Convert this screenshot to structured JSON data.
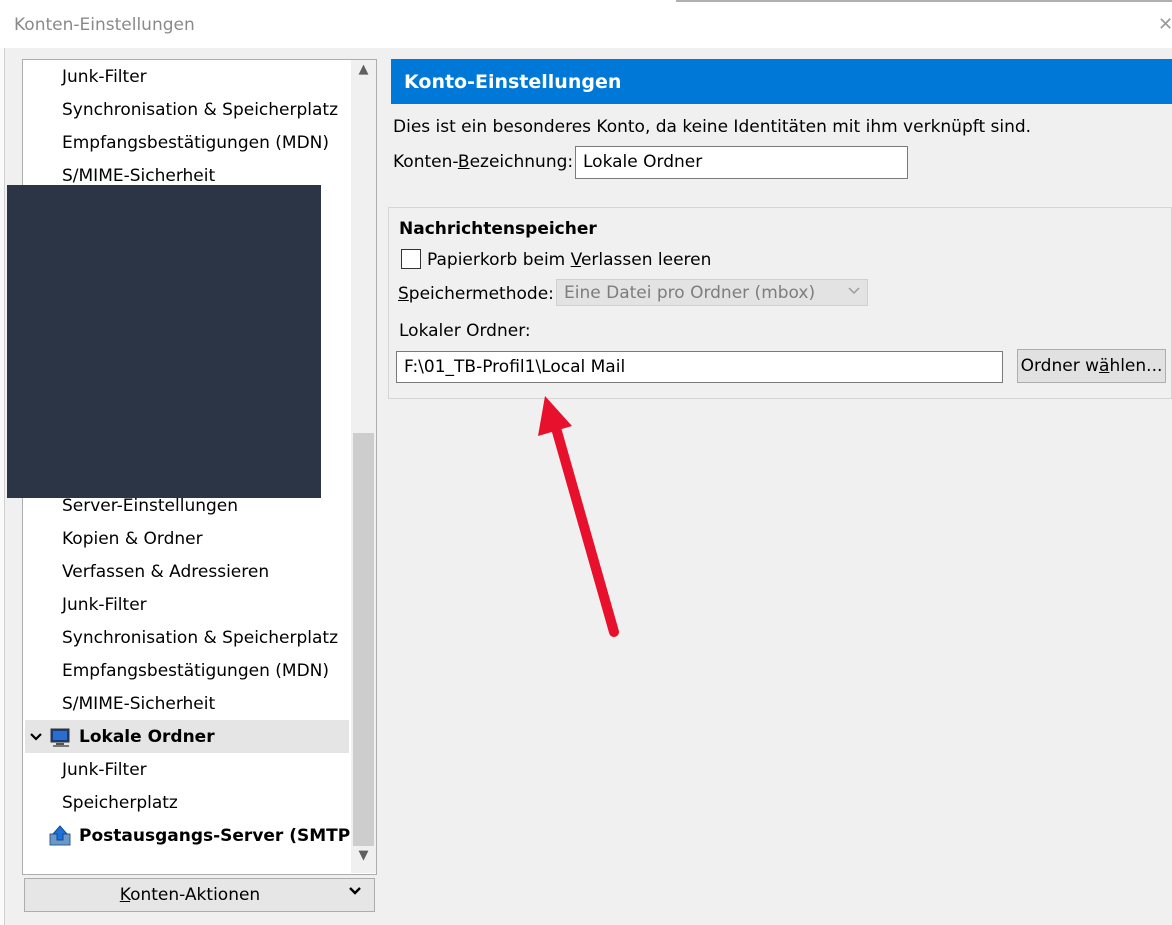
{
  "window": {
    "title": "Konten-Einstellungen",
    "close_glyph": "✕"
  },
  "tree": {
    "items": [
      {
        "label": "Junk-Filter"
      },
      {
        "label": "Synchronisation & Speicherplatz"
      },
      {
        "label": "Empfangsbestätigungen (MDN)"
      },
      {
        "label": "S/MIME-Sicherheit"
      },
      {
        "label": "Server-Einstellungen"
      },
      {
        "label": "Kopien & Ordner"
      },
      {
        "label": "Verfassen & Adressieren"
      },
      {
        "label": "Junk-Filter"
      },
      {
        "label": "Synchronisation & Speicherplatz"
      },
      {
        "label": "Empfangsbestätigungen (MDN)"
      },
      {
        "label": "S/MIME-Sicherheit"
      },
      {
        "label": "Lokale Ordner",
        "bold": true,
        "expanded": true,
        "icon": "computer-icon",
        "selected": true
      },
      {
        "label": "Junk-Filter"
      },
      {
        "label": "Speicherplatz"
      },
      {
        "label": "Postausgangs-Server (SMTP)",
        "bold": true,
        "icon": "upload-icon"
      }
    ]
  },
  "actions": {
    "label_prefix": "",
    "label_underlined": "K",
    "label_rest": "onten-Aktionen"
  },
  "panel": {
    "header": "Konto-Einstellungen",
    "notice": "Dies ist ein besonderes Konto, da keine Identitäten mit ihm verknüpft sind.",
    "name_label_pre": "Konten-",
    "name_label_ul": "B",
    "name_label_post": "ezeichnung:",
    "name_value": "Lokale Ordner",
    "group_title": "Nachrichtenspeicher",
    "checkbox_pre": "Papierkorb beim ",
    "checkbox_ul": "V",
    "checkbox_post": "erlassen leeren",
    "checkbox_checked": false,
    "method_ul": "S",
    "method_post": "peichermethode:",
    "method_value": "Eine Datei pro Ordner (mbox)",
    "folder_label": "Lokaler Ordner:",
    "folder_value": "F:\\01_TB-Profil1\\Local Mail",
    "choose_pre": "Ordner w",
    "choose_ul": "ä",
    "choose_post": "hlen..."
  },
  "colors": {
    "header_bg": "#0078d7",
    "arrow": "#e8112d",
    "redaction": "#2b3546"
  }
}
